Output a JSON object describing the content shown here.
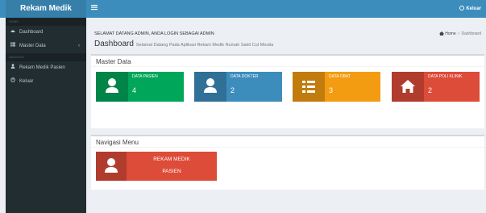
{
  "app": {
    "title": "Rekam Medik"
  },
  "topbar": {
    "menu_icon": "menu-icon",
    "logout_label": "Keluar"
  },
  "sidebar": {
    "header_main": "HOME",
    "header_nav": "NAVIGASI",
    "items": [
      {
        "label": "Dashboard",
        "icon": "dashboard-icon"
      },
      {
        "label": "Master Data",
        "icon": "table-icon",
        "chevron": "‹"
      },
      {
        "label": "Rekam Medik Pasien",
        "icon": "user-icon"
      },
      {
        "label": "Keluar",
        "icon": "power-icon"
      }
    ]
  },
  "content": {
    "welcome": "SELAMAT DATANG ADMIN, ANDA LOGIN SEBAGAI ADMIN",
    "title": "Dashboard",
    "subtitle": "Selamat Datang Pada Aplikasi Rekam Medik Rumah Sakit Cut Meutia",
    "breadcrumb": {
      "home": "Home",
      "current": "Dashboard"
    }
  },
  "master_data": {
    "title": "Master Data",
    "tiles": [
      {
        "label": "DATA PASIEN",
        "value": "4",
        "color": "#00a65a",
        "icon": "user-icon"
      },
      {
        "label": "DATA DOKTER",
        "value": "2",
        "color": "#3c8dbc",
        "icon": "user-icon"
      },
      {
        "label": "DATA OBAT",
        "value": "3",
        "color": "#f39c12",
        "icon": "list-icon"
      },
      {
        "label": "DATA POLI KLINIK",
        "value": "2",
        "color": "#dd4b39",
        "icon": "home-icon"
      }
    ]
  },
  "nav_menu": {
    "title": "Navigasi Menu",
    "button": {
      "line1": "REKAM MEDIK",
      "line2": "PASIEN",
      "color": "#dd4b39",
      "icon": "user-icon"
    }
  }
}
